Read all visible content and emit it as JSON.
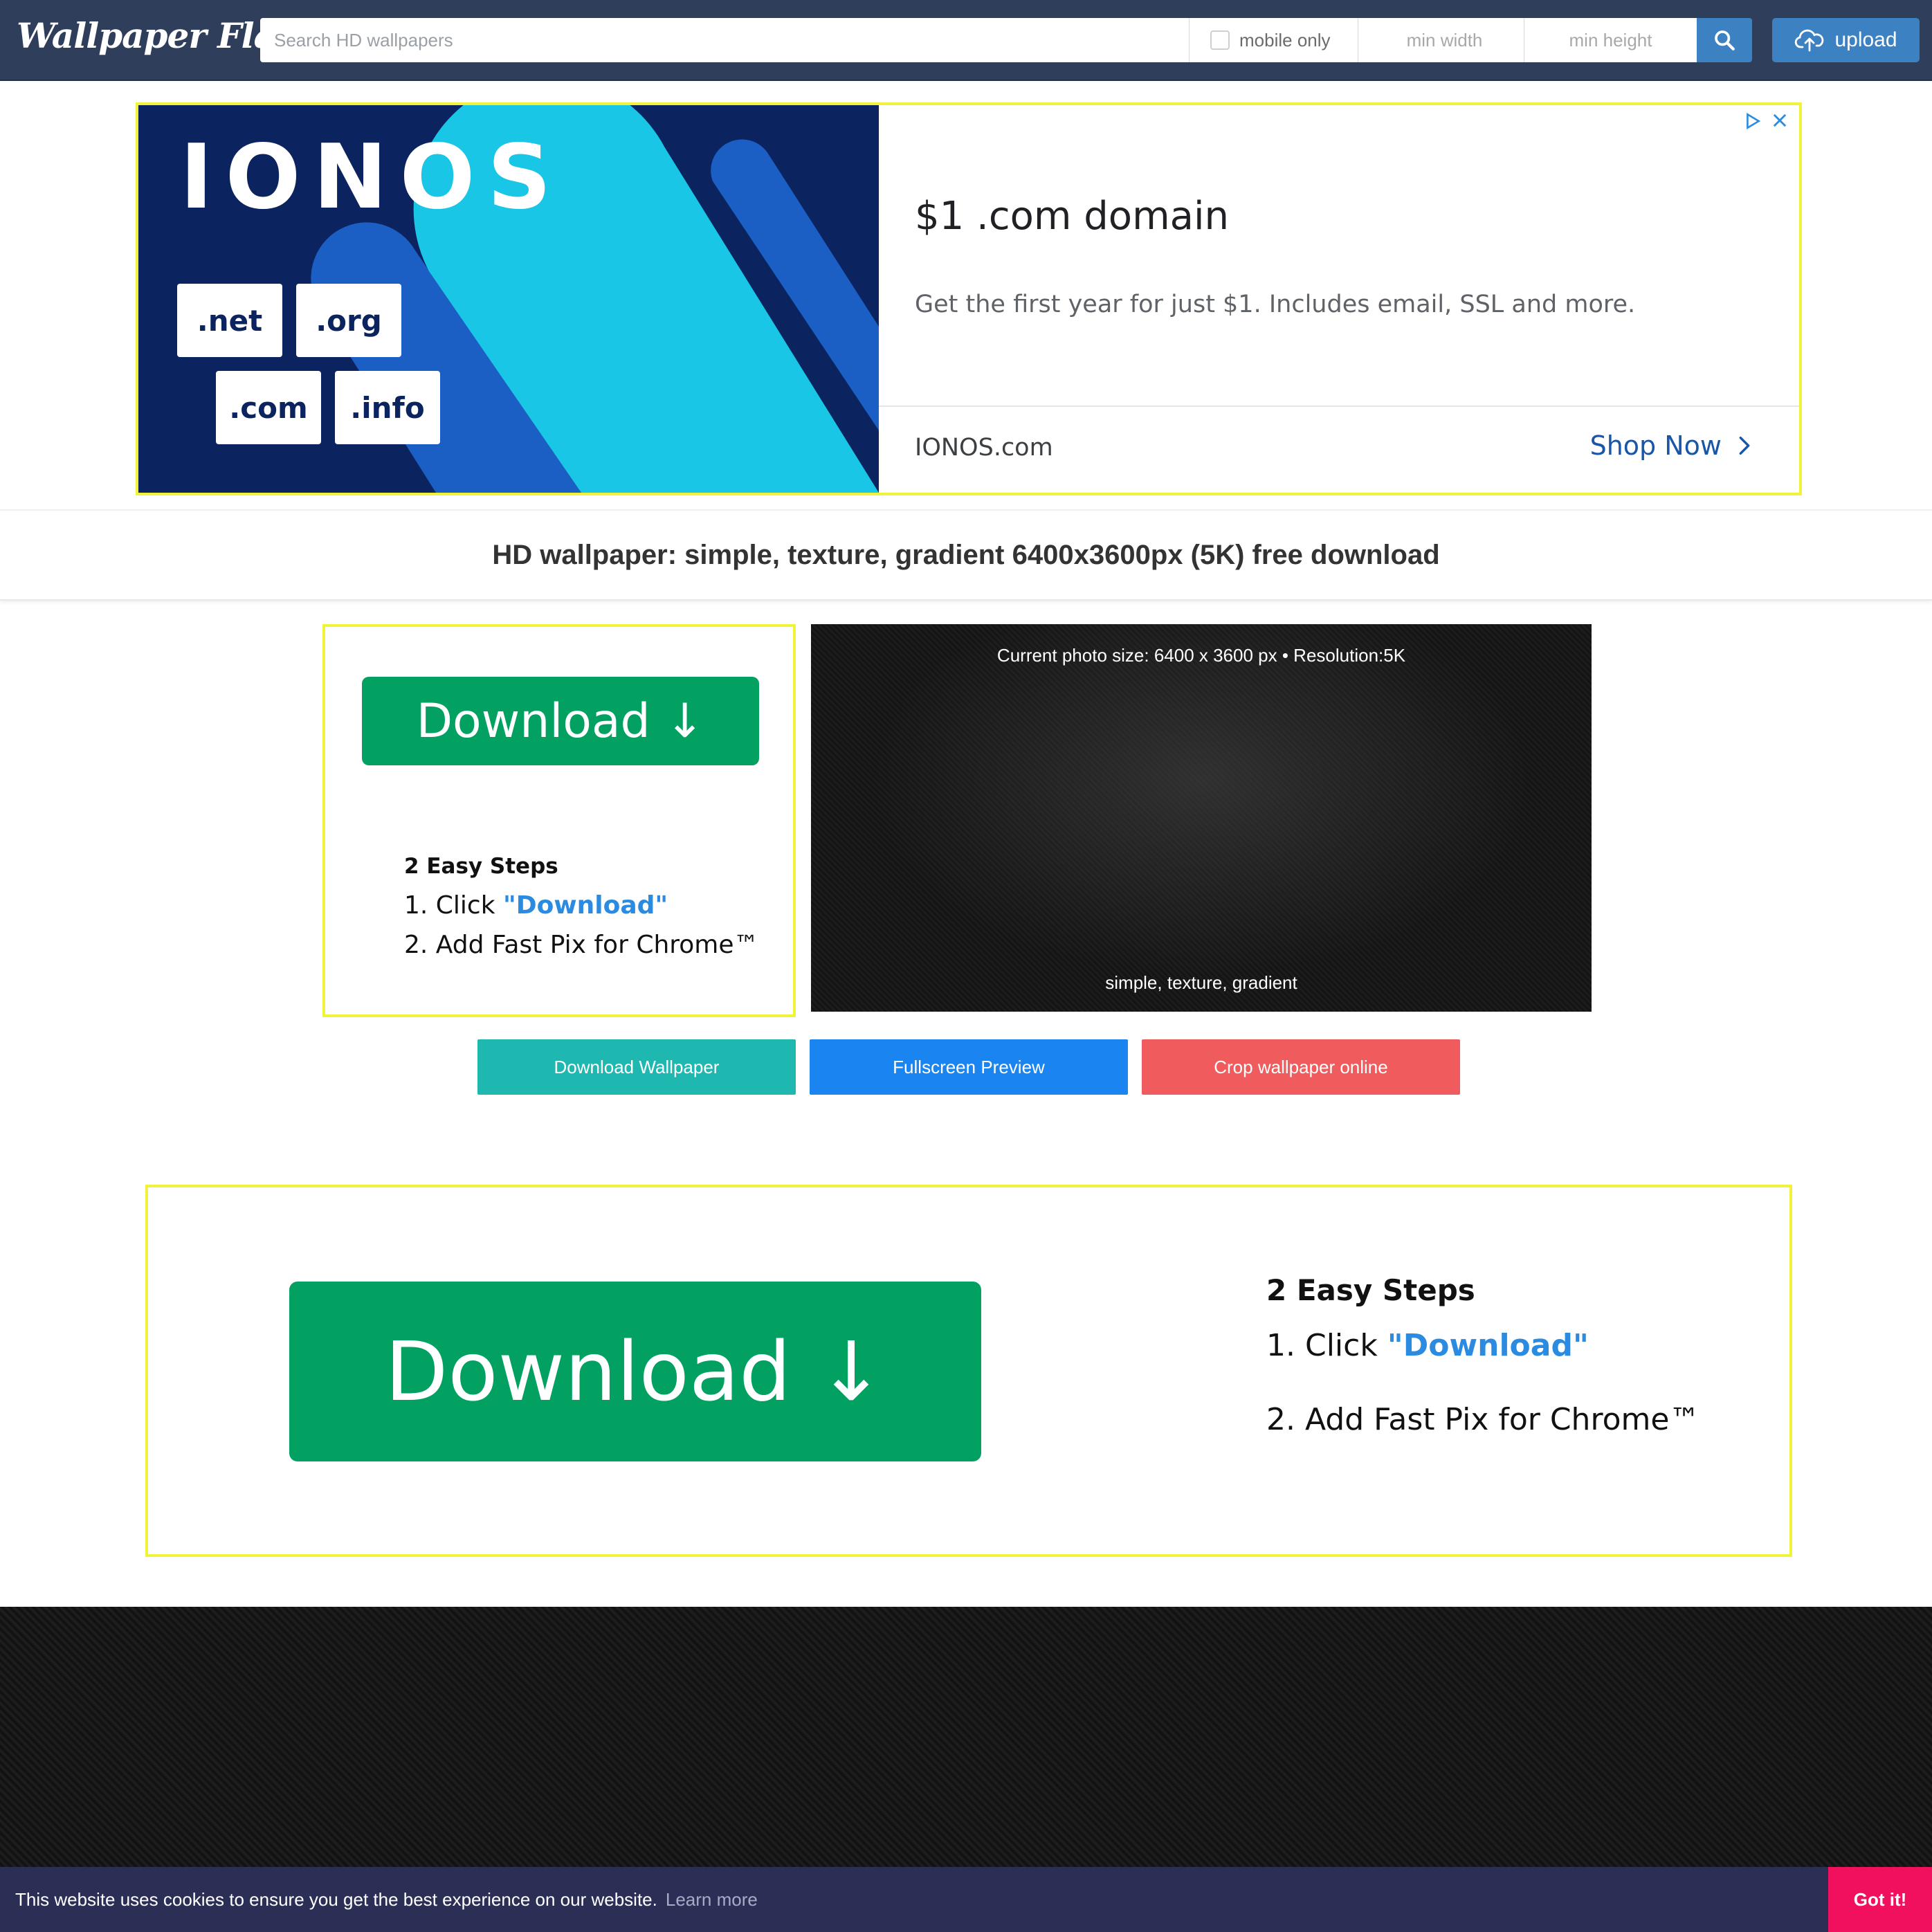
{
  "header": {
    "logo": "Wallpaper Flare",
    "search_placeholder": "Search HD wallpapers",
    "mobile_only_label": "mobile only",
    "min_width_placeholder": "min width",
    "min_height_placeholder": "min height",
    "upload_label": "upload"
  },
  "ad": {
    "brand_logo": "IONOS",
    "tlds": [
      ".net",
      ".org",
      ".com",
      ".info"
    ],
    "headline": "$1 .com domain",
    "description": "Get the first year for just $1. Includes email, SSL and more.",
    "domain": "IONOS.com",
    "cta": "Shop Now"
  },
  "page": {
    "title": "HD wallpaper: simple, texture, gradient 6400x3600px (5K) free download"
  },
  "download_box": {
    "button_label": "Download ↓",
    "steps_heading": "2 Easy Steps",
    "step1_prefix": "1. Click ",
    "step1_link": "\"Download\"",
    "step2": "2. Add Fast Pix for Chrome™"
  },
  "preview": {
    "size_info": "Current photo size: 6400 x 3600 px • Resolution:5K",
    "tags": "simple, texture, gradient"
  },
  "actions": {
    "download_wallpaper": "Download Wallpaper",
    "fullscreen_preview": "Fullscreen Preview",
    "crop_online": "Crop wallpaper online"
  },
  "cookie": {
    "message": "This website uses cookies to ensure you get the best experience on our website.",
    "learn_more": "Learn more",
    "accept": "Got it!"
  },
  "colors": {
    "header_bg": "#2f3e5a",
    "accent_blue": "#3c82c3",
    "download_green": "#02a162",
    "ad_border": "#f2f23a",
    "teal": "#1fb8b1",
    "blue": "#1a84f0",
    "red": "#f05c5e",
    "cookie_bg": "#2b2f56",
    "cookie_btn": "#f1105d"
  },
  "icons": [
    "search-icon",
    "cloud-upload-icon",
    "ad-choices-icon",
    "close-icon",
    "chevron-right-icon"
  ]
}
